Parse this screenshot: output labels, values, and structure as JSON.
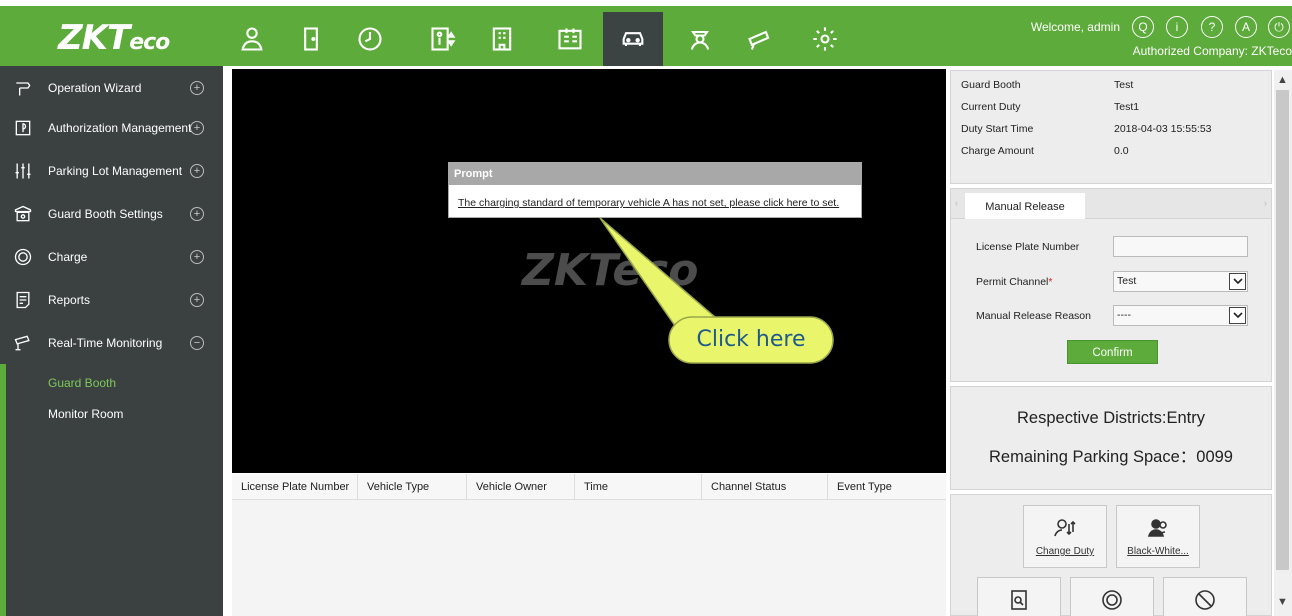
{
  "header": {
    "logo_main": "ZKT",
    "logo_sub": "eco",
    "welcome": "Welcome, admin",
    "authorized": "Authorized Company: ZKTeco",
    "nav_icons": [
      "person-icon",
      "door-icon",
      "clock-icon",
      "elevator-icon",
      "building-icon",
      "visitor-card-icon",
      "car-icon",
      "guard-icon",
      "camera-icon",
      "gear-icon"
    ],
    "active_nav": "car-icon",
    "header_icons": [
      "q-circle-icon",
      "info-circle-icon",
      "help-circle-icon",
      "user-circle-icon",
      "power-icon"
    ]
  },
  "sidebar": {
    "items": [
      {
        "label": "Operation Wizard",
        "icon": "wizard-icon",
        "toggle": "+"
      },
      {
        "label": "Authorization Management",
        "icon": "shield-icon",
        "toggle": "+"
      },
      {
        "label": "Parking Lot Management",
        "icon": "sliders-icon",
        "toggle": "+"
      },
      {
        "label": "Guard Booth Settings",
        "icon": "booth-icon",
        "toggle": "+"
      },
      {
        "label": "Charge",
        "icon": "coin-icon",
        "toggle": "+"
      },
      {
        "label": "Reports",
        "icon": "report-icon",
        "toggle": "+"
      },
      {
        "label": "Real-Time Monitoring",
        "icon": "cctv-icon",
        "toggle": "−"
      }
    ],
    "submenu": [
      {
        "label": "Guard Booth",
        "color": "#7ec85a"
      },
      {
        "label": "Monitor Room",
        "color": "#ffffff"
      }
    ]
  },
  "video": {
    "watermark": "ZKTeco",
    "prompt_title": "Prompt",
    "prompt_link": "The charging standard of temporary vehicle A has not set, please click here to set.",
    "callout": "Click here"
  },
  "events": {
    "columns": [
      "License Plate Number",
      "Vehicle Type",
      "Vehicle Owner",
      "Time",
      "Channel Status",
      "Event Type"
    ]
  },
  "info": {
    "rows": [
      {
        "label": "Guard Booth",
        "value": "Test"
      },
      {
        "label": "Current Duty",
        "value": "Test1"
      },
      {
        "label": "Duty Start Time",
        "value": "2018-04-03 15:55:53"
      },
      {
        "label": "Charge Amount",
        "value": "0.0"
      }
    ]
  },
  "release": {
    "tab": "Manual Release",
    "plate_label": "License Plate Number",
    "plate_value": "",
    "channel_label": "Permit Channel",
    "channel_req": "*",
    "channel_value": "Test",
    "reason_label": "Manual Release Reason",
    "reason_value": "----",
    "confirm": "Confirm"
  },
  "district": {
    "line1": "Respective Districts:Entry",
    "line2": "Remaining Parking Space：0099"
  },
  "actions": {
    "change_duty": "Change Duty",
    "black_white": "Black-White..."
  },
  "colors": {
    "brand_green": "#5dab3a",
    "sidebar_bg": "#3b4141",
    "callout_yellow": "#e9f56a"
  }
}
